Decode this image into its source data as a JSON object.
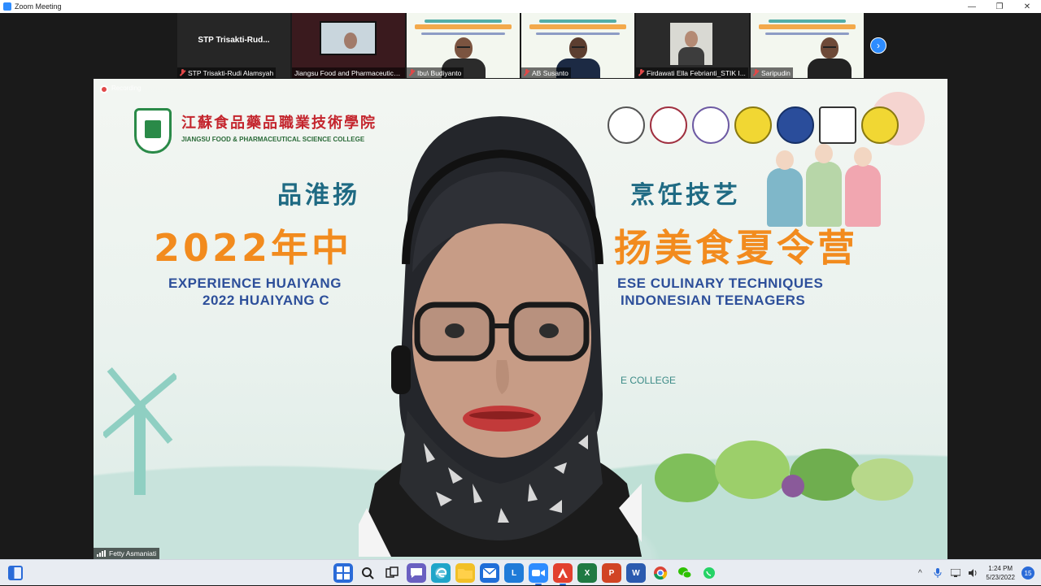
{
  "window": {
    "title": "Zoom Meeting",
    "minimize": "—",
    "maximize": "❐",
    "close": "✕"
  },
  "gallery": {
    "tiles": [
      {
        "name": "STP Trisakti-Rudi Alamsyah",
        "big_label": "STP  Trisakti-Rud...",
        "muted": true
      },
      {
        "name": "Jiangsu Food and Pharmaceutica...",
        "muted": false
      },
      {
        "name": "Ibu\\ Budiyanto",
        "muted": true
      },
      {
        "name": "AB Susanto",
        "muted": true
      },
      {
        "name": "Firdawati Ella Febrianti_STIK I...",
        "muted": true
      },
      {
        "name": "Saripudin",
        "muted": true
      }
    ],
    "next_icon": "›"
  },
  "speaker": {
    "name": "Fetty Asmaniati",
    "recording_label": "Recording",
    "slide": {
      "college_cn": "江蘇食品藥品職業技術學院",
      "college_en": "JIANGSU FOOD & PHARMACEUTICAL SCIENCE COLLEGE",
      "headline_cn1_left": "品淮扬",
      "headline_cn1_right": "烹饪技艺",
      "headline_cn2_left": "2022年中",
      "headline_cn2_right": "扬美食夏令营",
      "headline_en1_left": "EXPERIENCE HUAIYANG",
      "headline_en1_right": "ESE CULINARY TECHNIQUES",
      "headline_en2_left": "2022 HUAIYANG C",
      "headline_en2_right": "INDONESIAN TEENAGERS",
      "college_line": "E COLLEGE"
    }
  },
  "taskbar": {
    "apps": [
      {
        "name": "windows-start",
        "label": "",
        "color": "#2a6bd8",
        "active": false
      },
      {
        "name": "search",
        "label": "",
        "color": "#e8ecf2",
        "active": false
      },
      {
        "name": "task-view",
        "label": "",
        "color": "#e8ecf2",
        "active": false
      },
      {
        "name": "teams-chat",
        "label": "",
        "color": "#6a5fc1",
        "active": false
      },
      {
        "name": "edge",
        "label": "",
        "color": "#1fa5c9",
        "active": false
      },
      {
        "name": "file-explorer",
        "label": "",
        "color": "#f2c027",
        "active": false
      },
      {
        "name": "mail",
        "label": "",
        "color": "#1f6ed8",
        "active": false
      },
      {
        "name": "app-l",
        "label": "L",
        "color": "#1f7bd8",
        "active": false
      },
      {
        "name": "zoom",
        "label": "",
        "color": "#2d8cff",
        "active": true
      },
      {
        "name": "adobe",
        "label": "",
        "color": "#e2402f",
        "active": true
      },
      {
        "name": "excel",
        "label": "X",
        "color": "#1f7a43",
        "active": false
      },
      {
        "name": "powerpoint",
        "label": "P",
        "color": "#d14424",
        "active": false
      },
      {
        "name": "word",
        "label": "W",
        "color": "#2b5aaf",
        "active": false
      },
      {
        "name": "chrome",
        "label": "",
        "color": "#e8ecf2",
        "active": false
      },
      {
        "name": "wechat",
        "label": "",
        "color": "#e8ecf2",
        "active": false
      },
      {
        "name": "whatsapp",
        "label": "",
        "color": "#e8ecf2",
        "active": false
      }
    ],
    "tray": {
      "chevron": "^",
      "time": "1:24 PM",
      "date": "5/23/2022",
      "notifications": "15"
    }
  }
}
